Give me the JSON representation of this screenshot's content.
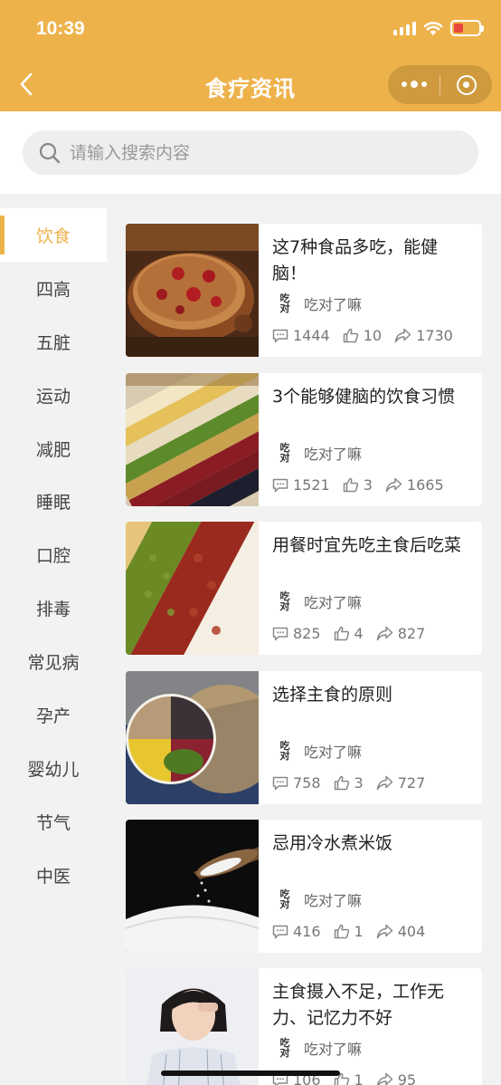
{
  "status_bar": {
    "time": "10:39"
  },
  "nav": {
    "title": "食疗资讯"
  },
  "search": {
    "placeholder": "请输入搜索内容"
  },
  "sidebar": {
    "items": [
      {
        "label": "饮食",
        "active": true
      },
      {
        "label": "四高"
      },
      {
        "label": "五脏"
      },
      {
        "label": "运动"
      },
      {
        "label": "减肥"
      },
      {
        "label": "睡眠"
      },
      {
        "label": "口腔"
      },
      {
        "label": "排毒"
      },
      {
        "label": "常见病"
      },
      {
        "label": "孕产"
      },
      {
        "label": "婴幼儿"
      },
      {
        "label": "节气"
      },
      {
        "label": "中医"
      }
    ]
  },
  "articles": [
    {
      "title": "这7种食品多吃，能健脑！",
      "author": "吃对了嘛",
      "comments": "1444",
      "likes": "10",
      "shares": "1730",
      "image": "porridge-bowl"
    },
    {
      "title": "3个能够健脑的饮食习惯",
      "author": "吃对了嘛",
      "comments": "1521",
      "likes": "3",
      "shares": "1665",
      "image": "grain-rows"
    },
    {
      "title": "用餐时宜先吃主食后吃菜",
      "author": "吃对了嘛",
      "comments": "825",
      "likes": "4",
      "shares": "827",
      "image": "beans-stripes"
    },
    {
      "title": "选择主食的原则",
      "author": "吃对了嘛",
      "comments": "758",
      "likes": "3",
      "shares": "727",
      "image": "grain-plate"
    },
    {
      "title": "忌用冷水煮米饭",
      "author": "吃对了嘛",
      "comments": "416",
      "likes": "1",
      "shares": "404",
      "image": "rice-spoon"
    },
    {
      "title": "主食摄入不足，工作无力、记忆力不好",
      "author": "吃对了嘛",
      "comments": "106",
      "likes": "1",
      "shares": "95",
      "image": "tired-woman"
    }
  ],
  "colors": {
    "accent": "#eeb24b",
    "page_bg": "#f2f2f2"
  }
}
